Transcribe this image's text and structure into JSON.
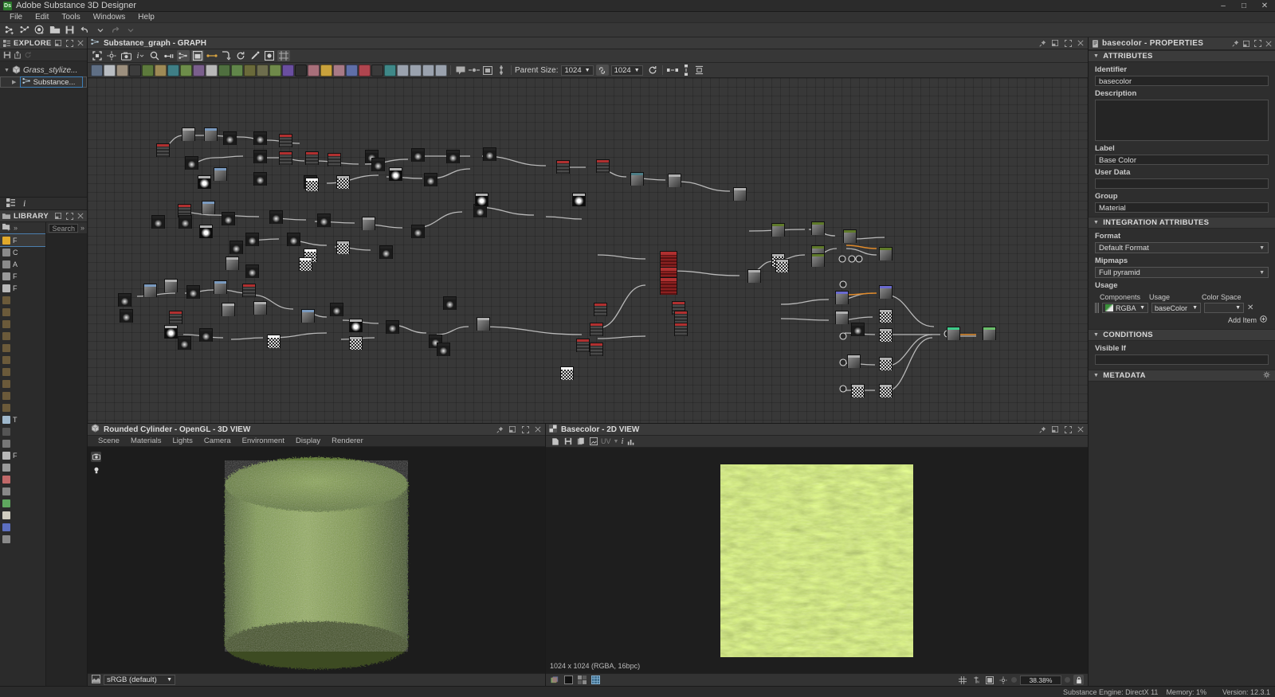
{
  "window": {
    "title": "Adobe Substance 3D Designer",
    "logo": "ds-logo",
    "minimize": "–",
    "maximize": "□",
    "close": "✕"
  },
  "menu": {
    "items": [
      "File",
      "Edit",
      "Tools",
      "Windows",
      "Help"
    ]
  },
  "main_toolbar": {
    "items": [
      {
        "name": "new-graph-icon"
      },
      {
        "name": "new-substance-icon"
      },
      {
        "name": "new-package-icon"
      },
      {
        "name": "open-folder-icon"
      },
      {
        "name": "save-icon"
      },
      {
        "name": "undo-icon"
      },
      {
        "name": "undo-dropdown-icon"
      },
      {
        "name": "redo-icon"
      },
      {
        "name": "redo-dropdown-icon"
      }
    ]
  },
  "explorer": {
    "title": "EXPLORER",
    "header_icon": "explorer-icon",
    "buttons": [
      "save-package-icon",
      "export-icon",
      "refresh-icon"
    ],
    "panel_buttons": [
      "dock-icon",
      "maximize-icon",
      "close-icon"
    ],
    "tree": [
      {
        "label": "Grass_stylize...",
        "icon": "package-icon",
        "expanded": true,
        "depth": 0
      },
      {
        "label": "Substance...",
        "icon": "graph-icon",
        "expanded": false,
        "depth": 1,
        "selected": true
      }
    ]
  },
  "tabstrip": {
    "tabs": [
      "explorer-tab-icon",
      "info-tab-icon"
    ]
  },
  "library": {
    "title": "LIBRARY",
    "header_icon": "library-folder-icon",
    "panel_buttons": [
      "dock-icon",
      "maximize-icon",
      "close-icon"
    ],
    "new-filter-icon": "new-filter-icon",
    "expand_icon": "»",
    "search": {
      "placeholder": "Search",
      "value": ""
    },
    "categories": [
      {
        "label": "F",
        "color": "#e0a92b",
        "icon": "star-icon",
        "highlight": true
      },
      {
        "label": "C",
        "color": "#8a8a8a",
        "icon": "comment-icon"
      },
      {
        "label": "A",
        "color": "#8a8a8a",
        "icon": "atomic-icon"
      },
      {
        "label": "F",
        "color": "#9a9a9a",
        "icon": "grid-icon"
      },
      {
        "label": "F",
        "color": "#b8b8b8",
        "icon": "folder-open-icon"
      },
      {
        "label": "",
        "color": "#6b5a3a",
        "icon": "filter-item-icon"
      },
      {
        "label": "",
        "color": "#6b5a3a",
        "icon": "filter-item-icon"
      },
      {
        "label": "",
        "color": "#6b5a3a",
        "icon": "filter-item-icon"
      },
      {
        "label": "",
        "color": "#6b5a3a",
        "icon": "filter-item-icon"
      },
      {
        "label": "",
        "color": "#6b5a3a",
        "icon": "filter-item-icon"
      },
      {
        "label": "",
        "color": "#6b5a3a",
        "icon": "filter-item-icon"
      },
      {
        "label": "",
        "color": "#6b5a3a",
        "icon": "filter-item-icon"
      },
      {
        "label": "",
        "color": "#6b5a3a",
        "icon": "filter-item-icon"
      },
      {
        "label": "",
        "color": "#6b5a3a",
        "icon": "filter-item-icon"
      },
      {
        "label": "",
        "color": "#6b5a3a",
        "icon": "filter-item-icon"
      },
      {
        "label": "T",
        "color": "#9fb8cc",
        "icon": "folder-open-icon"
      },
      {
        "label": "",
        "color": "#555555",
        "icon": "noise-icon"
      },
      {
        "label": "",
        "color": "#777777",
        "icon": "pattern-icon"
      },
      {
        "label": "F",
        "color": "#b8b8b8",
        "icon": "folder-open-icon"
      },
      {
        "label": "",
        "color": "#9a9a9a",
        "icon": "blur-icon"
      },
      {
        "label": "",
        "color": "#c06868",
        "icon": "color-icon"
      },
      {
        "label": "",
        "color": "#888888",
        "icon": "effect-icon"
      },
      {
        "label": "",
        "color": "#5fa85f",
        "icon": "channel-icon"
      },
      {
        "label": "",
        "color": "#d0cdc0",
        "icon": "tool-icon"
      },
      {
        "label": "",
        "color": "#5c6fc0",
        "icon": "material-icon"
      },
      {
        "label": "",
        "color": "#8a8a8a",
        "icon": "misc-icon"
      }
    ]
  },
  "graph": {
    "title": "Substance_graph - GRAPH",
    "header_icon": "graph-icon",
    "panel_buttons": [
      "pin-icon",
      "dock-icon",
      "maximize-icon",
      "close-icon"
    ],
    "toolbar_row1": [
      {
        "name": "select-tool-icon",
        "on": false
      },
      {
        "name": "move-tool-icon",
        "on": false
      },
      {
        "name": "screenshot-icon",
        "on": false
      },
      {
        "name": "info-icon",
        "on": false
      },
      {
        "name": "zoom-icon",
        "on": false
      },
      {
        "name": "link-creation-icon",
        "on": false
      },
      {
        "name": "graph-layout-icon",
        "on": true
      },
      {
        "name": "frame-icon",
        "on": true
      },
      {
        "name": "link-style-icon",
        "on": false
      },
      {
        "name": "curve-link-icon",
        "on": false
      },
      {
        "name": "rotate-icon",
        "on": false
      },
      {
        "name": "pen-icon",
        "on": false
      },
      {
        "name": "export-node-icon",
        "on": false
      },
      {
        "name": "align-grid-icon",
        "on": true
      }
    ],
    "toolbar_row2": [
      {
        "name": "bitmap-node-icon",
        "color": "#5f6f85"
      },
      {
        "name": "blend-node-icon",
        "color": "#b9bdc2"
      },
      {
        "name": "blur-node-icon",
        "color": "#9c8f7e"
      },
      {
        "name": "shuffle-node-icon",
        "color": "#3c3c3c"
      },
      {
        "name": "curve-node-icon",
        "color": "#5d7a3c"
      },
      {
        "name": "levels-node-icon",
        "color": "#9e8a56"
      },
      {
        "name": "normal-node-icon",
        "color": "#3f7f86"
      },
      {
        "name": "gradient-node-icon",
        "color": "#6d8d4a"
      },
      {
        "name": "warp-node-icon",
        "color": "#7a5f8c"
      },
      {
        "name": "tile-node-icon",
        "color": "#b8b8b8"
      },
      {
        "name": "transform-node-icon",
        "color": "#4f6f3f"
      },
      {
        "name": "shape-node-icon",
        "color": "#61864a"
      },
      {
        "name": "dot-node-icon",
        "color": "#6a6a3a"
      },
      {
        "name": "ellipse-node-icon",
        "color": "#6d6d4d"
      },
      {
        "name": "triangle-node-icon",
        "color": "#6f8a4a"
      },
      {
        "name": "hsl-node-icon",
        "color": "#6a4fa0"
      },
      {
        "name": "noise-node-icon",
        "color": "#2e2e2e"
      },
      {
        "name": "curvature-node-icon",
        "color": "#a86f7a"
      },
      {
        "name": "warning-node-icon",
        "color": "#c9a23c"
      },
      {
        "name": "text-node-icon",
        "color": "#a87a86"
      },
      {
        "name": "frame-node-icon",
        "color": "#5f6fa8"
      },
      {
        "name": "flood-node-icon",
        "color": "#b0454f"
      },
      {
        "name": "channel-node-icon",
        "color": "#3a3a3a"
      },
      {
        "name": "atlas-node-icon",
        "color": "#3f8888"
      },
      {
        "name": "out1-node-icon",
        "color": "#9aa2ae"
      },
      {
        "name": "out2-node-icon",
        "color": "#9aa2ae"
      },
      {
        "name": "out3-node-icon",
        "color": "#9aa2ae"
      },
      {
        "name": "out4-node-icon",
        "color": "#9aa2ae"
      }
    ],
    "toolbar_row2_extra": [
      {
        "name": "comment-icon"
      },
      {
        "name": "pin-link-icon"
      },
      {
        "name": "frame-select-icon"
      },
      {
        "name": "navigation-icon"
      }
    ],
    "parent_size_label": "Parent Size:",
    "size_x": "1024",
    "size_y": "1024",
    "link_icon": "chain-link-icon",
    "reset_icon": "reset-size-icon",
    "right_tools": [
      "horizontal-align-icon",
      "vertical-align-icon",
      "distribute-icon"
    ]
  },
  "view3d": {
    "title": "Rounded Cylinder - OpenGL - 3D VIEW",
    "header_icon": "mesh-icon",
    "panel_buttons": [
      "pin-icon",
      "dock-icon",
      "maximize-icon",
      "close-icon"
    ],
    "menu": [
      "Scene",
      "Materials",
      "Lights",
      "Camera",
      "Environment",
      "Display",
      "Renderer"
    ],
    "side_tools": [
      "camera-icon",
      "light-icon"
    ],
    "colorspace": "sRGB (default)",
    "colorspace_icon": "colorspace-icon",
    "bottom_left_icon": "tonemap-icon"
  },
  "view2d": {
    "title": "Basecolor - 2D VIEW",
    "header_icon": "image-icon",
    "panel_buttons": [
      "pin-icon",
      "dock-icon",
      "maximize-icon",
      "close-icon"
    ],
    "tools": [
      "new-view-icon",
      "save-image-icon",
      "copy-image-icon",
      "fit-icon",
      "uv-label",
      "info-icon",
      "histogram-icon"
    ],
    "uv_label": "UV",
    "dimensions": "1024 x 1024 (RGBA, 16bpc)",
    "bottom_tools": [
      "channels-icon",
      "alpha-icon",
      "tiling-icon",
      "grid-icon"
    ],
    "right_tools": [
      "grid-toggle-icon",
      "ruler-icon",
      "fill-icon",
      "pan-icon"
    ],
    "zoom_value": "38.38%",
    "lock_icon": "lock-icon"
  },
  "properties": {
    "title": "basecolor - PROPERTIES",
    "header_icon": "properties-icon",
    "panel_buttons": [
      "pin-icon",
      "dock-icon",
      "maximize-icon",
      "close-icon"
    ],
    "sections": {
      "attributes": "ATTRIBUTES",
      "integration": "INTEGRATION ATTRIBUTES",
      "conditions": "CONDITIONS",
      "metadata": "METADATA"
    },
    "fields": {
      "identifier_label": "Identifier",
      "identifier_value": "basecolor",
      "description_label": "Description",
      "description_value": "",
      "label_label": "Label",
      "label_value": "Base Color",
      "userdata_label": "User Data",
      "userdata_value": "",
      "group_label": "Group",
      "group_value": "Material",
      "format_label": "Format",
      "format_value": "Default Format",
      "mipmaps_label": "Mipmaps",
      "mipmaps_value": "Full pyramid",
      "usage_label": "Usage",
      "col_components": "Components",
      "col_usage": "Usage",
      "col_colorspace": "Color Space",
      "components_value": "RGBA",
      "usage_value": "baseColor",
      "colorspace_value": "",
      "add_item": "Add Item",
      "visible_if_label": "Visible If",
      "visible_if_value": ""
    }
  },
  "statusbar": {
    "engine": "Substance Engine: DirectX 11",
    "memory": "Memory: 1%",
    "version": "Version: 12.3.1"
  },
  "colors": {
    "accent": "#3d7fb8",
    "panel": "#2e2e2e",
    "header": "#3a3a3a",
    "canvas": "#383838",
    "link": "#b9b9b9",
    "link_highlight": "#e08a2a",
    "grass_green": "#6d8a3a"
  }
}
